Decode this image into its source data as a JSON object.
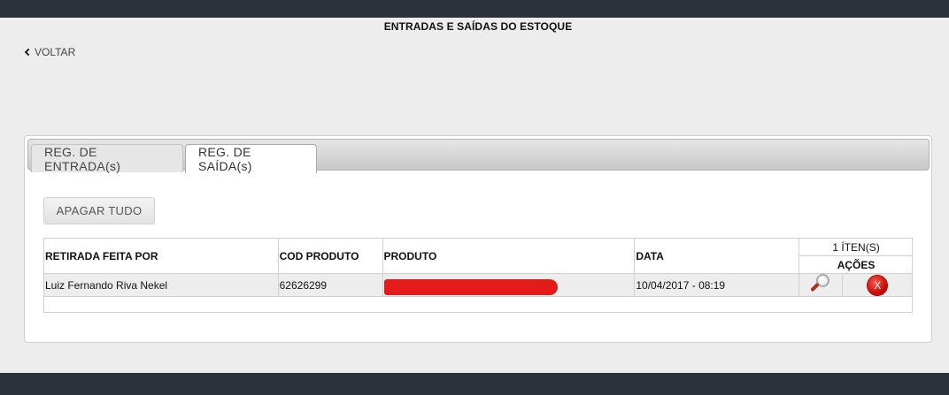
{
  "header": {
    "title": "ENTRADAS E SAÍDAS DO ESTOQUE",
    "back_label": "VOLTAR"
  },
  "tabs": [
    {
      "label": "REG. DE ENTRADA(s)",
      "active": false
    },
    {
      "label": "REG. DE SAÍDA(s)",
      "active": true
    }
  ],
  "actions": {
    "delete_all_label": "APAGAR TUDO"
  },
  "table": {
    "columns": [
      "RETIRADA FEITA POR",
      "COD PRODUTO",
      "PRODUTO",
      "DATA"
    ],
    "item_count": "1 ÍTEN(S)",
    "actions_header": "AÇÕES",
    "rows": [
      {
        "retirada_por": "Luiz Fernando Riva Nekel",
        "cod_produto": "62626299",
        "produto": "",
        "data": "10/04/2017 - 08:19",
        "view_icon": "magnifier-icon",
        "delete_icon": "delete-x-icon"
      }
    ]
  },
  "colors": {
    "top_bar": "#2d333b",
    "background": "#ededed",
    "redaction": "#e31b1b",
    "delete_button": "#c20000"
  }
}
